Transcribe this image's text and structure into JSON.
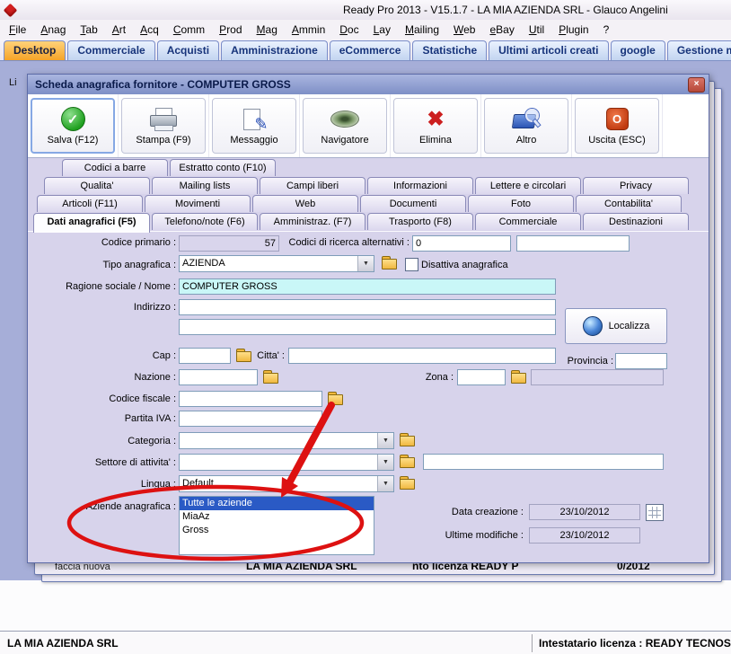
{
  "window": {
    "title": "Ready Pro 2013 - V15.1.7 - LA MIA AZIENDA SRL - Glauco Angelini"
  },
  "menu": {
    "items": [
      "File",
      "Anag",
      "Tab",
      "Art",
      "Acq",
      "Comm",
      "Prod",
      "Mag",
      "Ammin",
      "Doc",
      "Lay",
      "Mailing",
      "Web",
      "eBay",
      "Util",
      "Plugin",
      "?"
    ]
  },
  "main_tabs": {
    "active": "Desktop",
    "items": [
      "Desktop",
      "Commerciale",
      "Acquisti",
      "Amministrazione",
      "eCommerce",
      "Statistiche",
      "Ultimi articoli creati",
      "google",
      "Gestione messa"
    ]
  },
  "background": {
    "left_partial": "Li",
    "behind": {
      "fragment_left": "faccia nuova",
      "company": "LA MIA AZIENDA SRL",
      "fragment_license": "nto licenza READY P",
      "fragment_date": "0/2012"
    }
  },
  "dialog": {
    "title": "Scheda anagrafica fornitore - COMPUTER GROSS",
    "toolbar": {
      "buttons": [
        "Salva (F12)",
        "Stampa (F9)",
        "Messaggio",
        "Navigatore",
        "Elimina",
        "Altro",
        "Uscita (ESC)"
      ]
    },
    "tabs": {
      "row1": [
        "Codici a barre",
        "Estratto conto (F10)"
      ],
      "row2": [
        "Qualita'",
        "Mailing lists",
        "Campi liberi",
        "Informazioni",
        "Lettere e circolari",
        "Privacy"
      ],
      "row3": [
        "Articoli (F11)",
        "Movimenti",
        "Web",
        "Documenti",
        "Foto",
        "Contabilita'"
      ],
      "row4": [
        "Dati anagrafici (F5)",
        "Telefono/note (F6)",
        "Amministraz. (F7)",
        "Trasporto (F8)",
        "Commerciale",
        "Destinazioni"
      ],
      "active": "Dati anagrafici (F5)"
    },
    "form": {
      "codice_primario_label": "Codice primario :",
      "codice_primario": "57",
      "ricerca_label": "Codici di ricerca alternativi :",
      "ricerca_value": "0",
      "tipo_label": "Tipo anagrafica :",
      "tipo_value": "AZIENDA",
      "disattiva_label": "Disattiva anagrafica",
      "ragione_label": "Ragione sociale / Nome :",
      "ragione_value": "COMPUTER GROSS",
      "indirizzo_label": "Indirizzo :",
      "localizza_label": "Localizza",
      "cap_label": "Cap :",
      "citta_label": "Citta' :",
      "provincia_label": "Provincia :",
      "nazione_label": "Nazione :",
      "zona_label": "Zona :",
      "cf_label": "Codice fiscale :",
      "piva_label": "Partita IVA :",
      "categoria_label": "Categoria :",
      "settore_label": "Settore di attivita' :",
      "lingua_label": "Lingua :",
      "lingua_value": "Default",
      "aziende_label": "Aziende anagrafica :",
      "aziende_items": [
        "Tutte le aziende",
        "MiaAz",
        "Gross"
      ],
      "aziende_selected": "Tutte le aziende",
      "data_creazione_label": "Data creazione :",
      "data_creazione_value": "23/10/2012",
      "ultime_label": "Ultime modifiche :",
      "ultime_value": "23/10/2012"
    }
  },
  "status_bar": {
    "company": "LA MIA AZIENDA SRL",
    "license": "Intestatario licenza : READY TECNOS"
  },
  "icons": {
    "check": "✓",
    "delete": "✖",
    "pencil": "✎",
    "close": "×",
    "dropdown_arrow": "▼",
    "power": "O"
  },
  "colors": {
    "accent_orange": "#f5a428",
    "selection_blue": "#2a5ac5",
    "annotation_red": "#dd1111",
    "field_highlight": "#c9f7f7",
    "desktop_bg": "#a6aed8"
  }
}
